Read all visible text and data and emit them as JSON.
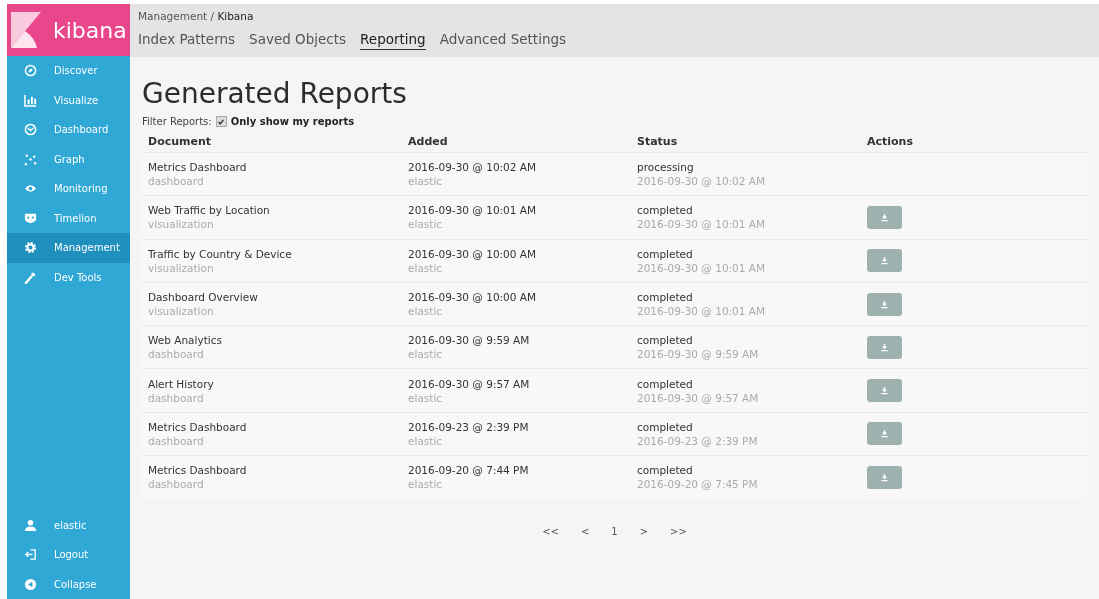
{
  "logo": {
    "text": "kibana"
  },
  "sidebar": {
    "items": [
      {
        "label": "Discover",
        "selected": false
      },
      {
        "label": "Visualize",
        "selected": false
      },
      {
        "label": "Dashboard",
        "selected": false
      },
      {
        "label": "Graph",
        "selected": false
      },
      {
        "label": "Monitoring",
        "selected": false
      },
      {
        "label": "Timelion",
        "selected": false
      },
      {
        "label": "Management",
        "selected": true
      },
      {
        "label": "Dev Tools",
        "selected": false
      }
    ],
    "bottom": [
      {
        "label": "elastic"
      },
      {
        "label": "Logout"
      },
      {
        "label": "Collapse"
      }
    ]
  },
  "breadcrumb": {
    "parent": "Management / ",
    "current": "Kibana"
  },
  "tabs": [
    {
      "label": "Index Patterns",
      "selected": false
    },
    {
      "label": "Saved Objects",
      "selected": false
    },
    {
      "label": "Reporting",
      "selected": true
    },
    {
      "label": "Advanced Settings",
      "selected": false
    }
  ],
  "title": "Generated Reports",
  "filter": {
    "label": "Filter Reports:",
    "option": "Only show my reports",
    "checked": true
  },
  "table": {
    "columns": [
      "Document",
      "Added",
      "Status",
      "Actions"
    ],
    "rows": [
      {
        "document": "Metrics Dashboard",
        "type": "dashboard",
        "added": "2016-09-30 @ 10:02 AM",
        "user": "elastic",
        "status": "processing",
        "status_time": "2016-09-30 @ 10:02 AM",
        "download": false
      },
      {
        "document": "Web Traffic by Location",
        "type": "visualization",
        "added": "2016-09-30 @ 10:01 AM",
        "user": "elastic",
        "status": "completed",
        "status_time": "2016-09-30 @ 10:01 AM",
        "download": true
      },
      {
        "document": "Traffic by Country & Device",
        "type": "visualization",
        "added": "2016-09-30 @ 10:00 AM",
        "user": "elastic",
        "status": "completed",
        "status_time": "2016-09-30 @ 10:01 AM",
        "download": true
      },
      {
        "document": "Dashboard Overview",
        "type": "visualization",
        "added": "2016-09-30 @ 10:00 AM",
        "user": "elastic",
        "status": "completed",
        "status_time": "2016-09-30 @ 10:01 AM",
        "download": true
      },
      {
        "document": "Web Analytics",
        "type": "dashboard",
        "added": "2016-09-30 @ 9:59 AM",
        "user": "elastic",
        "status": "completed",
        "status_time": "2016-09-30 @ 9:59 AM",
        "download": true
      },
      {
        "document": "Alert History",
        "type": "dashboard",
        "added": "2016-09-30 @ 9:57 AM",
        "user": "elastic",
        "status": "completed",
        "status_time": "2016-09-30 @ 9:57 AM",
        "download": true
      },
      {
        "document": "Metrics Dashboard",
        "type": "dashboard",
        "added": "2016-09-23 @ 2:39 PM",
        "user": "elastic",
        "status": "completed",
        "status_time": "2016-09-23 @ 2:39 PM",
        "download": true
      },
      {
        "document": "Metrics Dashboard",
        "type": "dashboard",
        "added": "2016-09-20 @ 7:44 PM",
        "user": "elastic",
        "status": "completed",
        "status_time": "2016-09-20 @ 7:45 PM",
        "download": true
      }
    ]
  },
  "pagination": [
    "<<",
    "<",
    "1",
    ">",
    ">>"
  ]
}
